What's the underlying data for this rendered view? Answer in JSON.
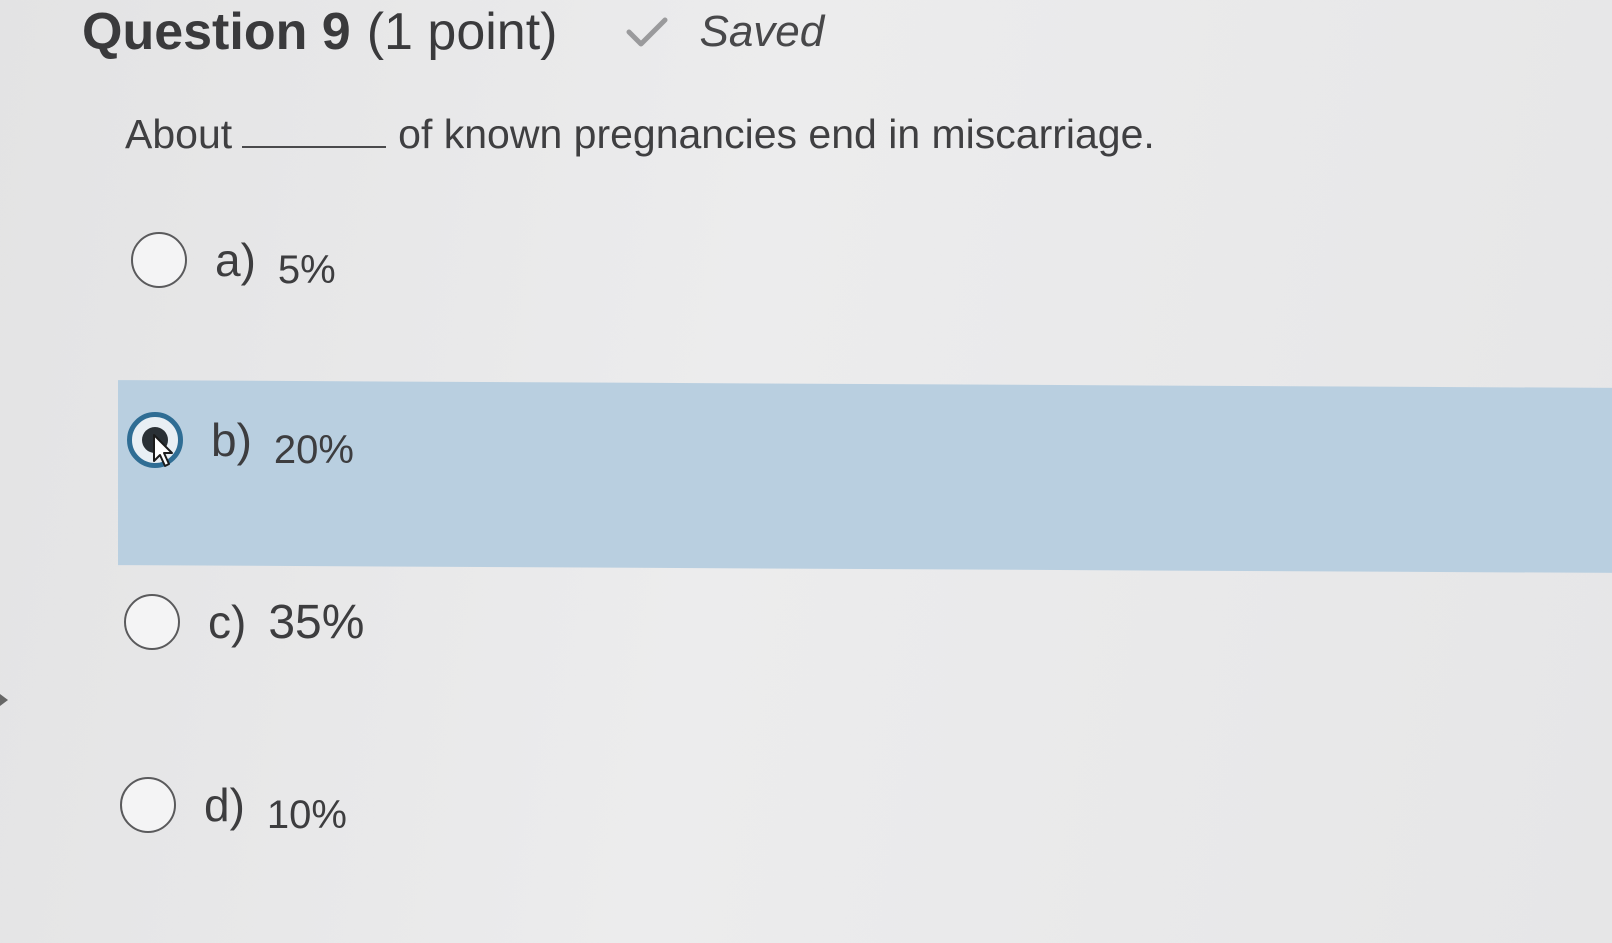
{
  "header": {
    "question_number": "Question 9",
    "points": "(1 point)",
    "status": "Saved",
    "status_icon": "checkmark-icon"
  },
  "question": {
    "prefix": "About",
    "suffix": "of known pregnancies end in miscarriage."
  },
  "options": [
    {
      "letter": "a)",
      "value": "5%",
      "selected": false
    },
    {
      "letter": "b)",
      "value": "20%",
      "selected": true
    },
    {
      "letter": "c)",
      "value": "35%",
      "selected": false
    },
    {
      "letter": "d)",
      "value": "10%",
      "selected": false
    }
  ],
  "colors": {
    "selected_band": "#b9cfe0",
    "radio_checked_ring": "#2f6d94",
    "text": "#3d3d3f"
  }
}
